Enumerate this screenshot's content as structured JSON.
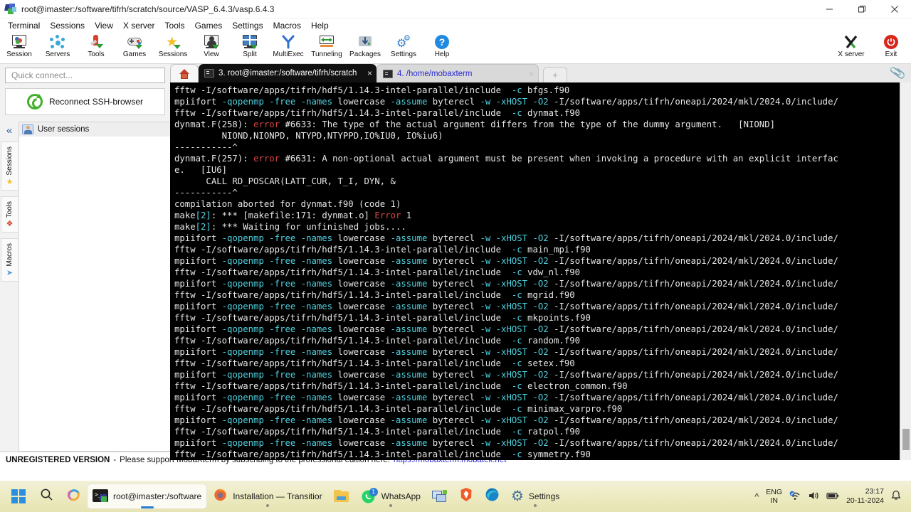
{
  "window": {
    "title": "root@imaster:/software/tifrh/scratch/source/VASP_6.4.3/vasp.6.4.3",
    "app_icon": "mobaxterm-logo-icon",
    "controls": {
      "minimize": "minimize-icon",
      "maximize": "maximize-icon",
      "close": "close-icon"
    }
  },
  "menubar": {
    "items": [
      "Terminal",
      "Sessions",
      "View",
      "X server",
      "Tools",
      "Games",
      "Settings",
      "Macros",
      "Help"
    ]
  },
  "ribbon": {
    "items": [
      {
        "label": "Session",
        "icon": "session-icon"
      },
      {
        "label": "Servers",
        "icon": "servers-icon"
      },
      {
        "label": "Tools",
        "icon": "tools-icon"
      },
      {
        "label": "Games",
        "icon": "games-gamepad-icon"
      },
      {
        "label": "Sessions",
        "icon": "sessions-star-icon"
      },
      {
        "label": "View",
        "icon": "view-icon"
      },
      {
        "label": "Split",
        "icon": "split-icon"
      },
      {
        "label": "MultiExec",
        "icon": "multiexec-icon"
      },
      {
        "label": "Tunneling",
        "icon": "tunneling-icon"
      },
      {
        "label": "Packages",
        "icon": "packages-icon"
      },
      {
        "label": "Settings",
        "icon": "settings-gear-icon"
      },
      {
        "label": "Help",
        "icon": "help-question-icon"
      }
    ],
    "right_items": [
      {
        "label": "X server",
        "icon": "x-server-icon"
      },
      {
        "label": "Exit",
        "icon": "exit-power-icon"
      }
    ]
  },
  "sidebar": {
    "quick_connect_placeholder": "Quick connect...",
    "reconnect_label": "Reconnect SSH-browser",
    "reconnect_icon": "refresh-circle-icon",
    "collapse_icon": "chevron-double-left-icon",
    "vertical_tabs": [
      {
        "label": "Sessions",
        "icon": "star-icon"
      },
      {
        "label": "Tools",
        "icon": "wrench-icon"
      },
      {
        "label": "Macros",
        "icon": "paper-plane-icon"
      }
    ],
    "session_tree": [
      {
        "label": "User sessions",
        "icon": "user-sessions-icon"
      }
    ]
  },
  "tabbar": {
    "home_icon": "home-icon",
    "add_label": "+",
    "attach_icon": "paperclip-icon",
    "tabs": [
      {
        "label": "3. root@imaster:/software/tifrh/scratch",
        "active": true,
        "close_label": "×"
      },
      {
        "label": "4. /home/mobaxterm",
        "active": false,
        "close_label": "×"
      }
    ]
  },
  "terminal": {
    "bg": "#000000",
    "fg": "#e6e6e6",
    "cyan": "#4fd2e0",
    "red": "#d74343",
    "lines": [
      [
        {
          "t": "fftw -I/software/apps/tifrh/hdf5/1.14.3-intel-parallel/include  ",
          "c": "w"
        },
        {
          "t": "-c",
          "c": "c"
        },
        {
          "t": " bfgs.f90",
          "c": "w"
        }
      ],
      [
        {
          "t": "mpiifort ",
          "c": "w"
        },
        {
          "t": "-qopenmp -free -names",
          "c": "c"
        },
        {
          "t": " lowercase ",
          "c": "w"
        },
        {
          "t": "-assume",
          "c": "c"
        },
        {
          "t": " byterecl ",
          "c": "w"
        },
        {
          "t": "-w -xHOST -O2",
          "c": "c"
        },
        {
          "t": " -I/software/apps/tifrh/oneapi/2024/mkl/2024.0/include/",
          "c": "w"
        }
      ],
      [
        {
          "t": "fftw -I/software/apps/tifrh/hdf5/1.14.3-intel-parallel/include  ",
          "c": "w"
        },
        {
          "t": "-c",
          "c": "c"
        },
        {
          "t": " dynmat.f90",
          "c": "w"
        }
      ],
      [
        {
          "t": "dynmat.F(258): ",
          "c": "w"
        },
        {
          "t": "error",
          "c": "r"
        },
        {
          "t": " #6633: The type of the actual argument differs from the type of the dummy argument.   [NIOND]",
          "c": "w"
        }
      ],
      [
        {
          "t": "         NIOND,NIONPD, NTYPD,NTYPPD,IO%IU0, IO%iu6)",
          "c": "w"
        }
      ],
      [
        {
          "t": "-----------^",
          "c": "w"
        }
      ],
      [
        {
          "t": "dynmat.F(257): ",
          "c": "w"
        },
        {
          "t": "error",
          "c": "r"
        },
        {
          "t": " #6631: A non-optional actual argument must be present when invoking a procedure with an explicit interfac",
          "c": "w"
        }
      ],
      [
        {
          "t": "e.   [IU6]",
          "c": "w"
        }
      ],
      [
        {
          "t": "      CALL RD_POSCAR(LATT_CUR, T_I, DYN, &",
          "c": "w"
        }
      ],
      [
        {
          "t": "-----------^",
          "c": "w"
        }
      ],
      [
        {
          "t": "compilation aborted for dynmat.f90 (code 1)",
          "c": "w"
        }
      ],
      [
        {
          "t": "make",
          "c": "w"
        },
        {
          "t": "[2]",
          "c": "c"
        },
        {
          "t": ": *** [makefile:171: dynmat.o] ",
          "c": "w"
        },
        {
          "t": "Error",
          "c": "r"
        },
        {
          "t": " 1",
          "c": "w"
        }
      ],
      [
        {
          "t": "make",
          "c": "w"
        },
        {
          "t": "[2]",
          "c": "c"
        },
        {
          "t": ": *** Waiting for unfinished jobs....",
          "c": "w"
        }
      ],
      [
        {
          "t": "mpiifort ",
          "c": "w"
        },
        {
          "t": "-qopenmp -free -names",
          "c": "c"
        },
        {
          "t": " lowercase ",
          "c": "w"
        },
        {
          "t": "-assume",
          "c": "c"
        },
        {
          "t": " byterecl ",
          "c": "w"
        },
        {
          "t": "-w -xHOST -O2",
          "c": "c"
        },
        {
          "t": " -I/software/apps/tifrh/oneapi/2024/mkl/2024.0/include/",
          "c": "w"
        }
      ],
      [
        {
          "t": "fftw -I/software/apps/tifrh/hdf5/1.14.3-intel-parallel/include  ",
          "c": "w"
        },
        {
          "t": "-c",
          "c": "c"
        },
        {
          "t": " main_mpi.f90",
          "c": "w"
        }
      ],
      [
        {
          "t": "mpiifort ",
          "c": "w"
        },
        {
          "t": "-qopenmp -free -names",
          "c": "c"
        },
        {
          "t": " lowercase ",
          "c": "w"
        },
        {
          "t": "-assume",
          "c": "c"
        },
        {
          "t": " byterecl ",
          "c": "w"
        },
        {
          "t": "-w -xHOST -O2",
          "c": "c"
        },
        {
          "t": " -I/software/apps/tifrh/oneapi/2024/mkl/2024.0/include/",
          "c": "w"
        }
      ],
      [
        {
          "t": "fftw -I/software/apps/tifrh/hdf5/1.14.3-intel-parallel/include  ",
          "c": "w"
        },
        {
          "t": "-c",
          "c": "c"
        },
        {
          "t": " vdw_nl.f90",
          "c": "w"
        }
      ],
      [
        {
          "t": "mpiifort ",
          "c": "w"
        },
        {
          "t": "-qopenmp -free -names",
          "c": "c"
        },
        {
          "t": " lowercase ",
          "c": "w"
        },
        {
          "t": "-assume",
          "c": "c"
        },
        {
          "t": " byterecl ",
          "c": "w"
        },
        {
          "t": "-w -xHOST -O2",
          "c": "c"
        },
        {
          "t": " -I/software/apps/tifrh/oneapi/2024/mkl/2024.0/include/",
          "c": "w"
        }
      ],
      [
        {
          "t": "fftw -I/software/apps/tifrh/hdf5/1.14.3-intel-parallel/include  ",
          "c": "w"
        },
        {
          "t": "-c",
          "c": "c"
        },
        {
          "t": " mgrid.f90",
          "c": "w"
        }
      ],
      [
        {
          "t": "mpiifort ",
          "c": "w"
        },
        {
          "t": "-qopenmp -free -names",
          "c": "c"
        },
        {
          "t": " lowercase ",
          "c": "w"
        },
        {
          "t": "-assume",
          "c": "c"
        },
        {
          "t": " byterecl ",
          "c": "w"
        },
        {
          "t": "-w -xHOST -O2",
          "c": "c"
        },
        {
          "t": " -I/software/apps/tifrh/oneapi/2024/mkl/2024.0/include/",
          "c": "w"
        }
      ],
      [
        {
          "t": "fftw -I/software/apps/tifrh/hdf5/1.14.3-intel-parallel/include  ",
          "c": "w"
        },
        {
          "t": "-c",
          "c": "c"
        },
        {
          "t": " mkpoints.f90",
          "c": "w"
        }
      ],
      [
        {
          "t": "mpiifort ",
          "c": "w"
        },
        {
          "t": "-qopenmp -free -names",
          "c": "c"
        },
        {
          "t": " lowercase ",
          "c": "w"
        },
        {
          "t": "-assume",
          "c": "c"
        },
        {
          "t": " byterecl ",
          "c": "w"
        },
        {
          "t": "-w -xHOST -O2",
          "c": "c"
        },
        {
          "t": " -I/software/apps/tifrh/oneapi/2024/mkl/2024.0/include/",
          "c": "w"
        }
      ],
      [
        {
          "t": "fftw -I/software/apps/tifrh/hdf5/1.14.3-intel-parallel/include  ",
          "c": "w"
        },
        {
          "t": "-c",
          "c": "c"
        },
        {
          "t": " random.f90",
          "c": "w"
        }
      ],
      [
        {
          "t": "mpiifort ",
          "c": "w"
        },
        {
          "t": "-qopenmp -free -names",
          "c": "c"
        },
        {
          "t": " lowercase ",
          "c": "w"
        },
        {
          "t": "-assume",
          "c": "c"
        },
        {
          "t": " byterecl ",
          "c": "w"
        },
        {
          "t": "-w -xHOST -O2",
          "c": "c"
        },
        {
          "t": " -I/software/apps/tifrh/oneapi/2024/mkl/2024.0/include/",
          "c": "w"
        }
      ],
      [
        {
          "t": "fftw -I/software/apps/tifrh/hdf5/1.14.3-intel-parallel/include  ",
          "c": "w"
        },
        {
          "t": "-c",
          "c": "c"
        },
        {
          "t": " setex.f90",
          "c": "w"
        }
      ],
      [
        {
          "t": "mpiifort ",
          "c": "w"
        },
        {
          "t": "-qopenmp -free -names",
          "c": "c"
        },
        {
          "t": " lowercase ",
          "c": "w"
        },
        {
          "t": "-assume",
          "c": "c"
        },
        {
          "t": " byterecl ",
          "c": "w"
        },
        {
          "t": "-w -xHOST -O2",
          "c": "c"
        },
        {
          "t": " -I/software/apps/tifrh/oneapi/2024/mkl/2024.0/include/",
          "c": "w"
        }
      ],
      [
        {
          "t": "fftw -I/software/apps/tifrh/hdf5/1.14.3-intel-parallel/include  ",
          "c": "w"
        },
        {
          "t": "-c",
          "c": "c"
        },
        {
          "t": " electron_common.f90",
          "c": "w"
        }
      ],
      [
        {
          "t": "mpiifort ",
          "c": "w"
        },
        {
          "t": "-qopenmp -free -names",
          "c": "c"
        },
        {
          "t": " lowercase ",
          "c": "w"
        },
        {
          "t": "-assume",
          "c": "c"
        },
        {
          "t": " byterecl ",
          "c": "w"
        },
        {
          "t": "-w -xHOST -O2",
          "c": "c"
        },
        {
          "t": " -I/software/apps/tifrh/oneapi/2024/mkl/2024.0/include/",
          "c": "w"
        }
      ],
      [
        {
          "t": "fftw -I/software/apps/tifrh/hdf5/1.14.3-intel-parallel/include  ",
          "c": "w"
        },
        {
          "t": "-c",
          "c": "c"
        },
        {
          "t": " minimax_varpro.f90",
          "c": "w"
        }
      ],
      [
        {
          "t": "mpiifort ",
          "c": "w"
        },
        {
          "t": "-qopenmp -free -names",
          "c": "c"
        },
        {
          "t": " lowercase ",
          "c": "w"
        },
        {
          "t": "-assume",
          "c": "c"
        },
        {
          "t": " byterecl ",
          "c": "w"
        },
        {
          "t": "-w -xHOST -O2",
          "c": "c"
        },
        {
          "t": " -I/software/apps/tifrh/oneapi/2024/mkl/2024.0/include/",
          "c": "w"
        }
      ],
      [
        {
          "t": "fftw -I/software/apps/tifrh/hdf5/1.14.3-intel-parallel/include  ",
          "c": "w"
        },
        {
          "t": "-c",
          "c": "c"
        },
        {
          "t": " ratpol.f90",
          "c": "w"
        }
      ],
      [
        {
          "t": "mpiifort ",
          "c": "w"
        },
        {
          "t": "-qopenmp -free -names",
          "c": "c"
        },
        {
          "t": " lowercase ",
          "c": "w"
        },
        {
          "t": "-assume",
          "c": "c"
        },
        {
          "t": " byterecl ",
          "c": "w"
        },
        {
          "t": "-w -xHOST -O2",
          "c": "c"
        },
        {
          "t": " -I/software/apps/tifrh/oneapi/2024/mkl/2024.0/include/",
          "c": "w"
        }
      ],
      [
        {
          "t": "fftw -I/software/apps/tifrh/hdf5/1.14.3-intel-parallel/include  ",
          "c": "w"
        },
        {
          "t": "-c",
          "c": "c"
        },
        {
          "t": " symmetry.f90",
          "c": "w"
        }
      ]
    ]
  },
  "nagbar": {
    "strong": "UNREGISTERED VERSION",
    "dash": "-",
    "text": "Please support MobaXterm by subscribing to the professional edition here:",
    "link": "https://mobaxterm.mobatek.net",
    "link_color": "#2a2ad0"
  },
  "taskbar": {
    "start_icon": "windows-start-icon",
    "search_icon": "search-icon",
    "copilot_icon": "copilot-icon",
    "buttons": [
      {
        "label": "root@imaster:/software",
        "icon": "mobaxterm-icon",
        "active": true,
        "badge": ""
      },
      {
        "label": "Installation — Transitior",
        "icon": "firefox-icon",
        "active": false,
        "badge": ""
      },
      {
        "label": "",
        "icon": "file-explorer-icon",
        "active": false,
        "badge": ""
      },
      {
        "label": "WhatsApp",
        "icon": "whatsapp-icon",
        "active": false,
        "badge": "1"
      },
      {
        "label": "",
        "icon": "remote-desktop-icon",
        "active": false,
        "badge": ""
      },
      {
        "label": "",
        "icon": "brave-icon",
        "active": false,
        "badge": ""
      },
      {
        "label": "",
        "icon": "edge-icon",
        "active": false,
        "badge": ""
      },
      {
        "label": "Settings",
        "icon": "settings-gear-icon",
        "active": false,
        "badge": ""
      }
    ],
    "tray": {
      "overflow_icon": "chevron-up-icon",
      "language_line1": "ENG",
      "language_line2": "IN",
      "network_icon": "wifi-icon",
      "volume_icon": "speaker-icon",
      "battery_icon": "battery-icon",
      "time": "23:17",
      "date": "20-11-2024",
      "notification_icon": "bell-icon"
    }
  }
}
